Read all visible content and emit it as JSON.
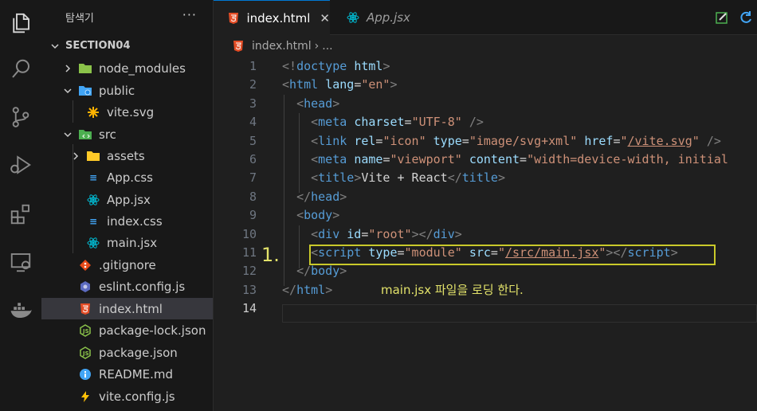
{
  "activity_bar": {
    "icons": [
      "explorer-icon",
      "search-icon",
      "source-control-icon",
      "run-debug-icon",
      "extensions-icon",
      "remote-explorer-icon",
      "docker-icon"
    ]
  },
  "sidebar": {
    "title": "탐색기",
    "more": "···",
    "section": "SECTION04",
    "items": [
      {
        "label": "node_modules",
        "type": "folder"
      },
      {
        "label": "public",
        "type": "folder"
      },
      {
        "label": "vite.svg",
        "type": "file"
      },
      {
        "label": "src",
        "type": "folder"
      },
      {
        "label": "assets",
        "type": "folder"
      },
      {
        "label": "App.css",
        "type": "file"
      },
      {
        "label": "App.jsx",
        "type": "file"
      },
      {
        "label": "index.css",
        "type": "file"
      },
      {
        "label": "main.jsx",
        "type": "file"
      },
      {
        "label": ".gitignore",
        "type": "file"
      },
      {
        "label": "eslint.config.js",
        "type": "file"
      },
      {
        "label": "index.html",
        "type": "file",
        "selected": true
      },
      {
        "label": "package-lock.json",
        "type": "file"
      },
      {
        "label": "package.json",
        "type": "file"
      },
      {
        "label": "README.md",
        "type": "file"
      },
      {
        "label": "vite.config.js",
        "type": "file"
      }
    ]
  },
  "tabs": [
    {
      "label": "index.html",
      "active": true,
      "close": "✕"
    },
    {
      "label": "App.jsx",
      "active": false
    }
  ],
  "breadcrumb": {
    "file": "index.html",
    "sep": "›",
    "rest": "..."
  },
  "editor": {
    "line_numbers": [
      "1",
      "2",
      "3",
      "4",
      "5",
      "6",
      "7",
      "8",
      "9",
      "10",
      "11",
      "12",
      "13",
      "14"
    ],
    "current_line": 14,
    "lines": [
      [
        [
          "br",
          "<!"
        ],
        [
          "tag",
          "doctype"
        ],
        [
          "txt",
          " "
        ],
        [
          "attr",
          "html"
        ],
        [
          "br",
          ">"
        ]
      ],
      [
        [
          "br",
          "<"
        ],
        [
          "tag",
          "html"
        ],
        [
          "txt",
          " "
        ],
        [
          "attr",
          "lang"
        ],
        [
          "txt",
          "="
        ],
        [
          "str",
          "\"en\""
        ],
        [
          "br",
          ">"
        ]
      ],
      [
        [
          "txt",
          "  "
        ],
        [
          "br",
          "<"
        ],
        [
          "tag",
          "head"
        ],
        [
          "br",
          ">"
        ]
      ],
      [
        [
          "txt",
          "    "
        ],
        [
          "br",
          "<"
        ],
        [
          "tag",
          "meta"
        ],
        [
          "txt",
          " "
        ],
        [
          "attr",
          "charset"
        ],
        [
          "txt",
          "="
        ],
        [
          "str",
          "\"UTF-8\""
        ],
        [
          "txt",
          " "
        ],
        [
          "br",
          "/>"
        ]
      ],
      [
        [
          "txt",
          "    "
        ],
        [
          "br",
          "<"
        ],
        [
          "tag",
          "link"
        ],
        [
          "txt",
          " "
        ],
        [
          "attr",
          "rel"
        ],
        [
          "txt",
          "="
        ],
        [
          "str",
          "\"icon\""
        ],
        [
          "txt",
          " "
        ],
        [
          "attr",
          "type"
        ],
        [
          "txt",
          "="
        ],
        [
          "str",
          "\"image/svg+xml\""
        ],
        [
          "txt",
          " "
        ],
        [
          "attr",
          "href"
        ],
        [
          "txt",
          "="
        ],
        [
          "str",
          "\""
        ],
        [
          "link",
          "/vite.svg"
        ],
        [
          "str",
          "\""
        ],
        [
          "txt",
          " "
        ],
        [
          "br",
          "/>"
        ]
      ],
      [
        [
          "txt",
          "    "
        ],
        [
          "br",
          "<"
        ],
        [
          "tag",
          "meta"
        ],
        [
          "txt",
          " "
        ],
        [
          "attr",
          "name"
        ],
        [
          "txt",
          "="
        ],
        [
          "str",
          "\"viewport\""
        ],
        [
          "txt",
          " "
        ],
        [
          "attr",
          "content"
        ],
        [
          "txt",
          "="
        ],
        [
          "str",
          "\"width=device-width, initial"
        ]
      ],
      [
        [
          "txt",
          "    "
        ],
        [
          "br",
          "<"
        ],
        [
          "tag",
          "title"
        ],
        [
          "br",
          ">"
        ],
        [
          "txt",
          "Vite + React"
        ],
        [
          "br",
          "</"
        ],
        [
          "tag",
          "title"
        ],
        [
          "br",
          ">"
        ]
      ],
      [
        [
          "txt",
          "  "
        ],
        [
          "br",
          "</"
        ],
        [
          "tag",
          "head"
        ],
        [
          "br",
          ">"
        ]
      ],
      [
        [
          "txt",
          "  "
        ],
        [
          "br",
          "<"
        ],
        [
          "tag",
          "body"
        ],
        [
          "br",
          ">"
        ]
      ],
      [
        [
          "txt",
          "    "
        ],
        [
          "br",
          "<"
        ],
        [
          "tag",
          "div"
        ],
        [
          "txt",
          " "
        ],
        [
          "attr",
          "id"
        ],
        [
          "txt",
          "="
        ],
        [
          "str",
          "\"root\""
        ],
        [
          "br",
          "></"
        ],
        [
          "tag",
          "div"
        ],
        [
          "br",
          ">"
        ]
      ],
      [
        [
          "txt",
          "    "
        ],
        [
          "br",
          "<"
        ],
        [
          "tag",
          "script"
        ],
        [
          "txt",
          " "
        ],
        [
          "attr",
          "type"
        ],
        [
          "txt",
          "="
        ],
        [
          "str",
          "\"module\""
        ],
        [
          "txt",
          " "
        ],
        [
          "attr",
          "src"
        ],
        [
          "txt",
          "="
        ],
        [
          "str",
          "\""
        ],
        [
          "link",
          "/src/main.jsx"
        ],
        [
          "str",
          "\""
        ],
        [
          "br",
          "></"
        ],
        [
          "tag",
          "script"
        ],
        [
          "br",
          ">"
        ]
      ],
      [
        [
          "txt",
          "  "
        ],
        [
          "br",
          "</"
        ],
        [
          "tag",
          "body"
        ],
        [
          "br",
          ">"
        ]
      ],
      [
        [
          "br",
          "</"
        ],
        [
          "tag",
          "html"
        ],
        [
          "br",
          ">"
        ]
      ],
      []
    ]
  },
  "annotation": {
    "number": "1.",
    "text": "main.jsx 파일을 로딩 한다."
  },
  "colors": {
    "accent": "#0078d4",
    "annotation": "#e2e26a",
    "html_icon": "#e44d26",
    "css_icon": "#42a5f5",
    "react_icon": "#00bcd4"
  }
}
